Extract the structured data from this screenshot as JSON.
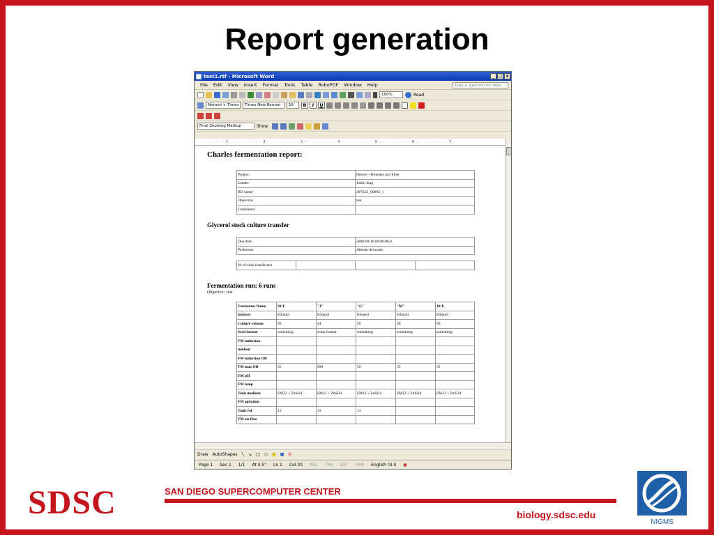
{
  "slide": {
    "title": "Report generation",
    "logo_text": "SDSC",
    "org_name": "SAN DIEGO SUPERCOMPUTER CENTER",
    "url": "biology.sdsc.edu",
    "nigms_label": "NIGMS",
    "accent_color": "#c4161c",
    "nigms_color": "#1f5fa8"
  },
  "window": {
    "title": "test1.rtf - Microsoft Word",
    "menu": [
      "File",
      "Edit",
      "View",
      "Insert",
      "Format",
      "Tools",
      "Table",
      "RoboPDF",
      "Window",
      "Help"
    ],
    "ask_placeholder": "Type a question for help",
    "zoom": "100%",
    "read_label": "Read",
    "style_value": "Normal + Times",
    "font_value": "Times New Roman",
    "size_value": "16",
    "bold_label": "B",
    "italic_label": "I",
    "underline_label": "U",
    "markup_value": "Final Showing Markup",
    "show_label": "Show",
    "ruler_text": "· · · · · · 1 · · · · · · · · · 2 · · · · · · · · · 3 · · · · · · · · · 4 · · · · · · · · · 5 · · · · · · · · · 6 · · · · · · · · · 7 ·",
    "draw_label": "Draw",
    "autoshapes_label": "AutoShapes",
    "status": {
      "page": "Page 1",
      "sec": "Sec 1",
      "pages": "1/1",
      "at": "At 0.5\"",
      "ln": "Ln 1",
      "col": "Col 30",
      "rec": "REC",
      "trk": "TRK",
      "ext": "EXT",
      "ovr": "OVR",
      "lang": "English (U.S"
    }
  },
  "doc": {
    "title": "Charles fermentation report:",
    "project_rows": [
      [
        "Project:",
        "Denver - Biomass and Fiber"
      ],
      [
        "Leader:",
        "Justin Stag"
      ],
      [
        "BD name:",
        "297ES2_00003_1"
      ],
      [
        "Objective:",
        "test"
      ],
      [
        "Comments:",
        ""
      ]
    ],
    "glycerol_heading": "Glycerol stock culture transfer",
    "glycerol_rows": [
      [
        "Due date:",
        "2006-09-18 00:00:00.0"
      ],
      [
        "Performer:",
        "Alberto Alvarado"
      ]
    ],
    "vials_label": "Nr of vials transferred",
    "fermentation_heading": "Fermentation run: 6 runs",
    "fermentation_objective": "Objective : test",
    "ferm_rows": [
      [
        "Fermentor Name",
        "30-F",
        "\"J\"",
        "\"G\"",
        "\"M\"",
        "10-E"
      ],
      [
        "Inducer",
        "Ethanol",
        "Ethanol",
        "Ethanol",
        "Ethanol",
        "Ethanol"
      ],
      [
        "Culture volume",
        "99",
        "44",
        "99",
        "99",
        "99"
      ],
      [
        "Seed format",
        "something",
        "some format",
        "something",
        "something",
        "something"
      ],
      [
        "FM induction",
        "",
        "",
        "",
        "",
        ""
      ],
      [
        "method",
        "",
        "",
        "",
        "",
        ""
      ],
      [
        "FM induction OD",
        "",
        "",
        "",
        "",
        ""
      ],
      [
        "FM max OD",
        "55",
        "999",
        "55",
        "55",
        "55"
      ],
      [
        "FM pH",
        "",
        "",
        "",
        "",
        ""
      ],
      [
        "FM temp",
        "",
        "",
        "",
        "",
        ""
      ],
      [
        "Tank medium",
        "FM22 + ZnSO4",
        "FM22 + ZnSO4",
        "FM22 + ZnSO4",
        "FM22 + ZnSO4",
        "FM22 + ZnSO4"
      ],
      [
        "FM agitation",
        "",
        "",
        "",
        "",
        ""
      ],
      [
        "Tank vol",
        "13",
        "13",
        "13",
        "",
        ""
      ],
      [
        "FM air flow",
        "",
        "",
        "",
        "",
        ""
      ]
    ]
  }
}
